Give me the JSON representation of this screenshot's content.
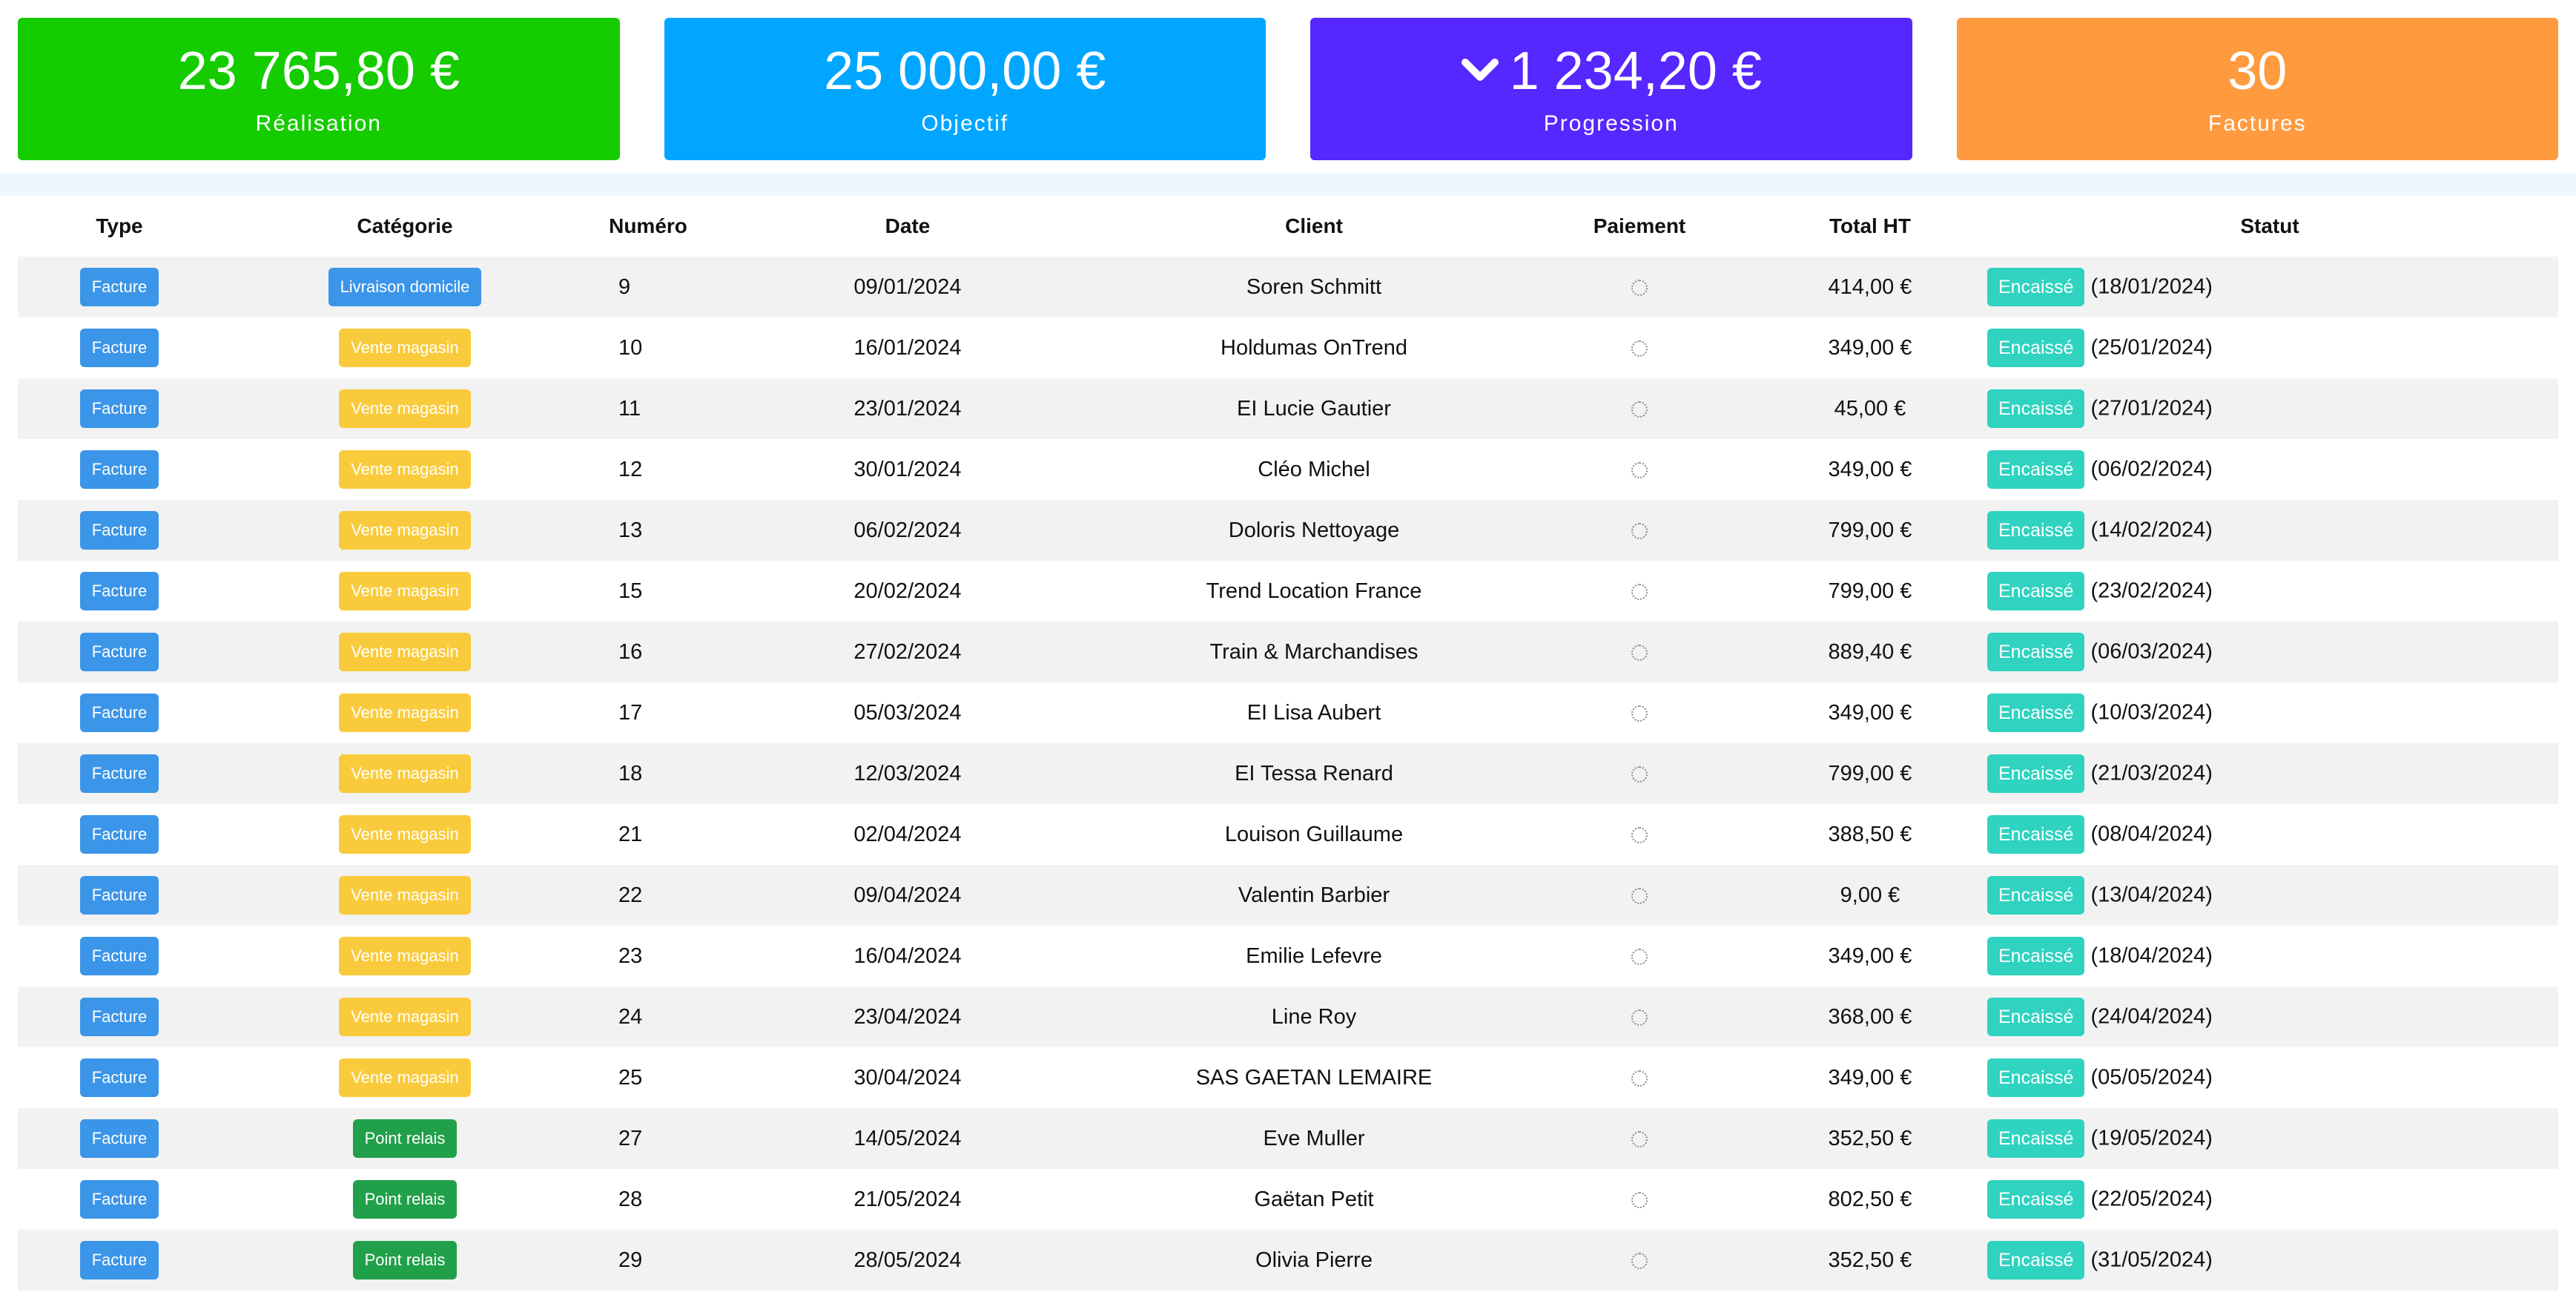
{
  "kpis": [
    {
      "value": "23 765,80 €",
      "label": "Réalisation",
      "color": "#15cc00",
      "icon": ""
    },
    {
      "value": "25 000,00 €",
      "label": "Objectif",
      "color": "#00a6ff",
      "icon": ""
    },
    {
      "value": "1 234,20 €",
      "label": "Progression",
      "color": "#5627ff",
      "icon": "chevron-down-icon"
    },
    {
      "value": "30",
      "label": "Factures",
      "color": "#ff9a3f",
      "icon": ""
    }
  ],
  "table": {
    "headers": [
      "Type",
      "Catégorie",
      "Numéro",
      "Date",
      "Client",
      "Paiement",
      "Total HT",
      "Statut"
    ],
    "category_colors": {
      "Livraison domicile": "#3b95e8",
      "Vente magasin": "#f9cb3c",
      "Point relais": "#21a04a"
    },
    "type_color": "#3b95e8",
    "status_color": "#2fd3c0",
    "payment_icon": "dotted-circle-icon",
    "rows": [
      {
        "type": "Facture",
        "category": "Livraison domicile",
        "number": "9",
        "date": "09/01/2024",
        "client": "Soren Schmitt",
        "total": "414,00 €",
        "status": "Encaissé",
        "status_date": "(18/01/2024)"
      },
      {
        "type": "Facture",
        "category": "Vente magasin",
        "number": "10",
        "date": "16/01/2024",
        "client": "Holdumas OnTrend",
        "total": "349,00 €",
        "status": "Encaissé",
        "status_date": "(25/01/2024)"
      },
      {
        "type": "Facture",
        "category": "Vente magasin",
        "number": "11",
        "date": "23/01/2024",
        "client": "EI Lucie Gautier",
        "total": "45,00 €",
        "status": "Encaissé",
        "status_date": "(27/01/2024)"
      },
      {
        "type": "Facture",
        "category": "Vente magasin",
        "number": "12",
        "date": "30/01/2024",
        "client": "Cléo Michel",
        "total": "349,00 €",
        "status": "Encaissé",
        "status_date": "(06/02/2024)"
      },
      {
        "type": "Facture",
        "category": "Vente magasin",
        "number": "13",
        "date": "06/02/2024",
        "client": "Doloris Nettoyage",
        "total": "799,00 €",
        "status": "Encaissé",
        "status_date": "(14/02/2024)"
      },
      {
        "type": "Facture",
        "category": "Vente magasin",
        "number": "15",
        "date": "20/02/2024",
        "client": "Trend Location France",
        "total": "799,00 €",
        "status": "Encaissé",
        "status_date": "(23/02/2024)"
      },
      {
        "type": "Facture",
        "category": "Vente magasin",
        "number": "16",
        "date": "27/02/2024",
        "client": "Train & Marchandises",
        "total": "889,40 €",
        "status": "Encaissé",
        "status_date": "(06/03/2024)"
      },
      {
        "type": "Facture",
        "category": "Vente magasin",
        "number": "17",
        "date": "05/03/2024",
        "client": "EI Lisa Aubert",
        "total": "349,00 €",
        "status": "Encaissé",
        "status_date": "(10/03/2024)"
      },
      {
        "type": "Facture",
        "category": "Vente magasin",
        "number": "18",
        "date": "12/03/2024",
        "client": "EI Tessa Renard",
        "total": "799,00 €",
        "status": "Encaissé",
        "status_date": "(21/03/2024)"
      },
      {
        "type": "Facture",
        "category": "Vente magasin",
        "number": "21",
        "date": "02/04/2024",
        "client": "Louison Guillaume",
        "total": "388,50 €",
        "status": "Encaissé",
        "status_date": "(08/04/2024)"
      },
      {
        "type": "Facture",
        "category": "Vente magasin",
        "number": "22",
        "date": "09/04/2024",
        "client": "Valentin Barbier",
        "total": "9,00 €",
        "status": "Encaissé",
        "status_date": "(13/04/2024)"
      },
      {
        "type": "Facture",
        "category": "Vente magasin",
        "number": "23",
        "date": "16/04/2024",
        "client": "Emilie Lefevre",
        "total": "349,00 €",
        "status": "Encaissé",
        "status_date": "(18/04/2024)"
      },
      {
        "type": "Facture",
        "category": "Vente magasin",
        "number": "24",
        "date": "23/04/2024",
        "client": "Line Roy",
        "total": "368,00 €",
        "status": "Encaissé",
        "status_date": "(24/04/2024)"
      },
      {
        "type": "Facture",
        "category": "Vente magasin",
        "number": "25",
        "date": "30/04/2024",
        "client": "SAS GAETAN LEMAIRE",
        "total": "349,00 €",
        "status": "Encaissé",
        "status_date": "(05/05/2024)"
      },
      {
        "type": "Facture",
        "category": "Point relais",
        "number": "27",
        "date": "14/05/2024",
        "client": "Eve Muller",
        "total": "352,50 €",
        "status": "Encaissé",
        "status_date": "(19/05/2024)"
      },
      {
        "type": "Facture",
        "category": "Point relais",
        "number": "28",
        "date": "21/05/2024",
        "client": "Gaëtan Petit",
        "total": "802,50 €",
        "status": "Encaissé",
        "status_date": "(22/05/2024)"
      },
      {
        "type": "Facture",
        "category": "Point relais",
        "number": "29",
        "date": "28/05/2024",
        "client": "Olivia Pierre",
        "total": "352,50 €",
        "status": "Encaissé",
        "status_date": "(31/05/2024)"
      }
    ]
  }
}
